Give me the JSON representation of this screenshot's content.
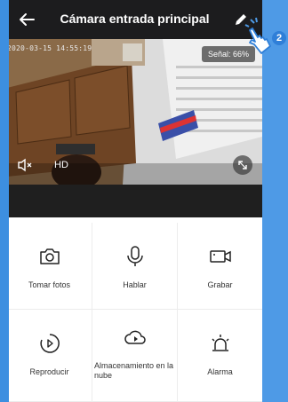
{
  "header": {
    "title": "Cámara entrada principal"
  },
  "video": {
    "timestamp": "2020-03-15 14:55:19",
    "signal": "Señal: 66%",
    "quality": "HD"
  },
  "actions": [
    {
      "label": "Tomar fotos",
      "icon": "camera-icon"
    },
    {
      "label": "Hablar",
      "icon": "microphone-icon"
    },
    {
      "label": "Grabar",
      "icon": "video-record-icon"
    },
    {
      "label": "Reproducir",
      "icon": "playback-icon"
    },
    {
      "label": "Almacenamiento en la nube",
      "icon": "cloud-play-icon"
    },
    {
      "label": "Alarma",
      "icon": "alarm-icon"
    }
  ],
  "annotation": {
    "step": "2"
  },
  "colors": {
    "header_bg": "#1c1c1e",
    "accent_blue": "#4e9ae6"
  }
}
